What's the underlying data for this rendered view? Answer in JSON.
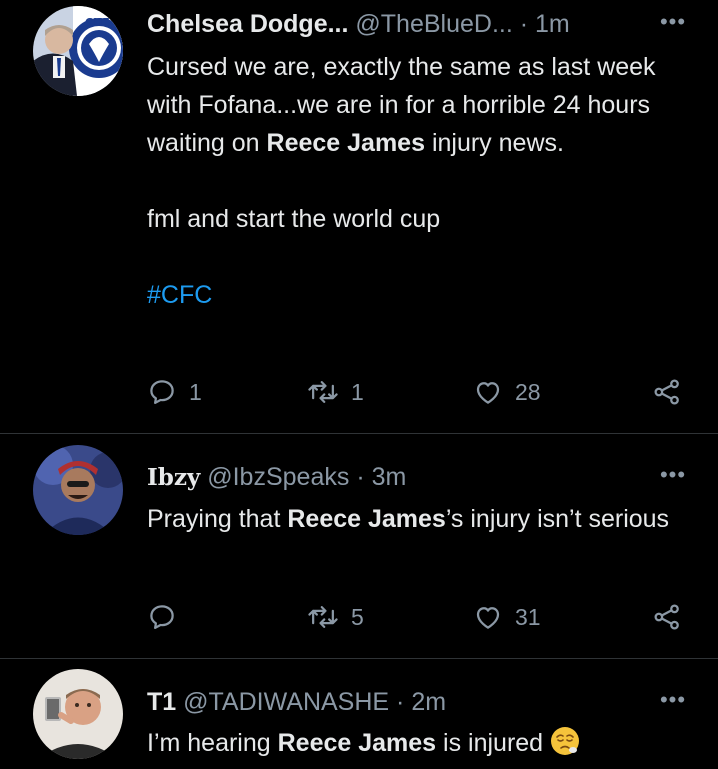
{
  "tweets": [
    {
      "name": "Chelsea Dodge...",
      "handle": "@TheBlueD...",
      "dot": "·",
      "time": "1m",
      "more": "•••",
      "body": {
        "line1_pre": "Cursed we are, exactly the same as last week with Fofana...we are in for a horrible 24 hours waiting on ",
        "line1_hl": "Reece James",
        "line1_post": " injury news.",
        "line2": "fml and start the world cup",
        "hashtag": "#CFC"
      },
      "actions": {
        "reply_count": "1",
        "retweet_count": "1",
        "like_count": "28"
      }
    },
    {
      "name": "Ibzy",
      "handle": "@IbzSpeaks",
      "dot": "·",
      "time": "3m",
      "more": "•••",
      "body": {
        "pre": "Praying that ",
        "hl": "Reece James",
        "post": "’s injury isn’t serious"
      },
      "actions": {
        "reply_count": "",
        "retweet_count": "5",
        "like_count": "31"
      }
    },
    {
      "name": "T1",
      "handle": "@TADIWANASHE",
      "dot": "·",
      "time": "2m",
      "more": "•••",
      "body": {
        "pre": "I’m hearing ",
        "hl": "Reece James",
        "post": " is injured"
      },
      "emoji": "worried-face-emoji"
    }
  ],
  "colors": {
    "background": "#000000",
    "text": "#e7e9ea",
    "muted": "#8b98a5",
    "link": "#1d9bf0",
    "divider": "#2f3336"
  }
}
